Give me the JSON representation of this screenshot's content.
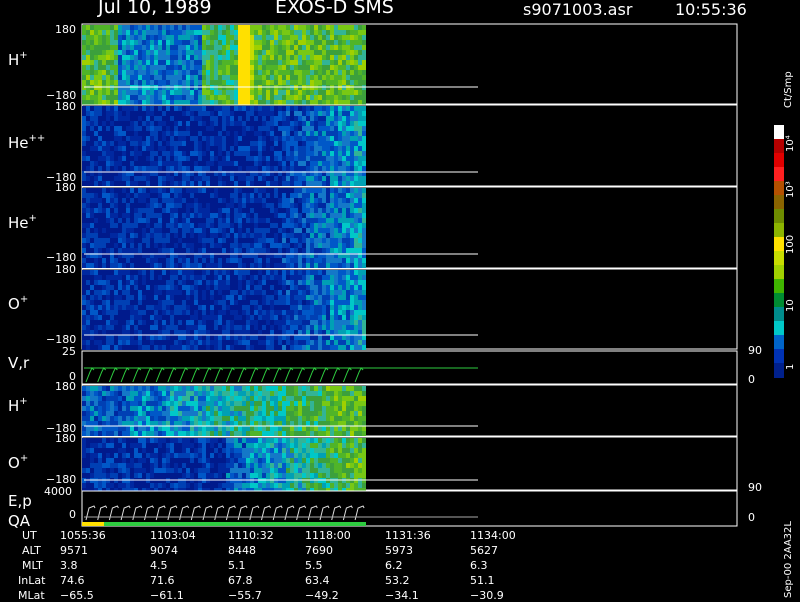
{
  "header": {
    "date": "Jul 10, 1989",
    "instrument": "EXOS-D SMS",
    "file": "s9071003.asr",
    "time": "10:55:36"
  },
  "panels": [
    {
      "label": "H",
      "sup": "+",
      "top_tick": "180",
      "bot_tick": "−180"
    },
    {
      "label": "He",
      "sup": "++",
      "top_tick": "180",
      "bot_tick": "−180"
    },
    {
      "label": "He",
      "sup": "+",
      "top_tick": "180",
      "bot_tick": "−180"
    },
    {
      "label": "O",
      "sup": "+",
      "top_tick": "180",
      "bot_tick": "−180"
    },
    {
      "label": "V,r",
      "sup": "",
      "top_tick": "25",
      "bot_tick": "0",
      "right_top": "90",
      "right_bot": "0"
    },
    {
      "label": "H",
      "sup": "+",
      "top_tick": "180",
      "bot_tick": "−180"
    },
    {
      "label": "O",
      "sup": "+",
      "top_tick": "180",
      "bot_tick": "−180",
      "right_bot": "90"
    },
    {
      "label": "E,p",
      "sup": "",
      "label2": "QA",
      "top_tick": "4000",
      "bot_tick": "0",
      "right_bot": "0"
    }
  ],
  "colorbar": {
    "title": "Ct/Smp",
    "ticks": [
      "10⁴",
      "10³",
      "100",
      "10",
      "1"
    ],
    "colors": [
      "#ffffff",
      "#b40000",
      "#e00000",
      "#ff2020",
      "#b45000",
      "#8a6400",
      "#6e8c00",
      "#8cb400",
      "#ffe000",
      "#c8dc00",
      "#a0d000",
      "#40b400",
      "#008c32",
      "#008c8c",
      "#00c8c8",
      "#0064c8",
      "#0032b4",
      "#00208c"
    ]
  },
  "orbit": {
    "labels": [
      "UT",
      "ALT",
      "MLT",
      "InLat",
      "MLat"
    ],
    "columns": [
      [
        "1055:36",
        "9571",
        "3.8",
        "74.6",
        "−65.5"
      ],
      [
        "1103:04",
        "9074",
        "4.5",
        "71.6",
        "−61.1"
      ],
      [
        "1110:32",
        "8448",
        "5.1",
        "67.8",
        "−55.7"
      ],
      [
        "1118:00",
        "7690",
        "5.5",
        "63.4",
        "−49.2"
      ],
      [
        "1131:36",
        "5973",
        "6.2",
        "53.2",
        "−34.1"
      ],
      [
        "1134:00",
        "5627",
        "6.3",
        "51.1",
        "−30.9"
      ]
    ]
  },
  "version": "Sep-00  2AA32L",
  "chart_data": {
    "type": "heatmap",
    "title": "Jul 10, 1989   EXOS-D SMS",
    "x_tick_labels": [
      "1055:36",
      "1103:04",
      "1110:32",
      "1118:00",
      "1131:36",
      "1134:00"
    ],
    "panels": [
      "H+",
      "He++",
      "He+",
      "O+",
      "V,r",
      "H+",
      "O+",
      "E,p QA"
    ],
    "colorbar_scale": "log",
    "colorbar_range": [
      1,
      10000
    ],
    "colorbar_units": "Ct/Smp"
  }
}
